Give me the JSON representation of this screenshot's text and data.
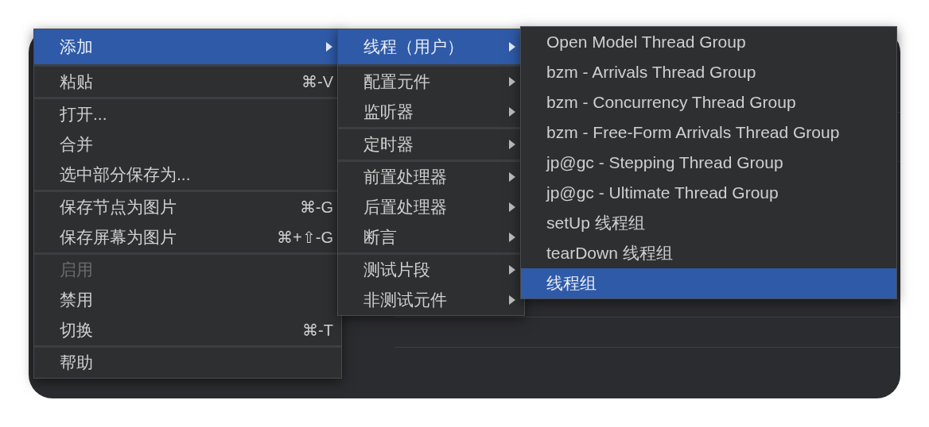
{
  "menus": [
    {
      "groups": [
        [
          {
            "label": "添加",
            "submenu": true,
            "selected": true,
            "disabled": false
          }
        ],
        [
          {
            "label": "粘贴",
            "shortcut": "⌘-V",
            "submenu": false,
            "selected": false,
            "disabled": false
          }
        ],
        [
          {
            "label": "打开...",
            "submenu": false,
            "selected": false,
            "disabled": false
          },
          {
            "label": "合并",
            "submenu": false,
            "selected": false,
            "disabled": false
          },
          {
            "label": "选中部分保存为...",
            "submenu": false,
            "selected": false,
            "disabled": false
          }
        ],
        [
          {
            "label": "保存节点为图片",
            "shortcut": "⌘-G",
            "submenu": false,
            "selected": false,
            "disabled": false
          },
          {
            "label": "保存屏幕为图片",
            "shortcut": "⌘+⇧-G",
            "submenu": false,
            "selected": false,
            "disabled": false
          }
        ],
        [
          {
            "label": "启用",
            "submenu": false,
            "selected": false,
            "disabled": true
          },
          {
            "label": "禁用",
            "submenu": false,
            "selected": false,
            "disabled": false
          },
          {
            "label": "切换",
            "shortcut": "⌘-T",
            "submenu": false,
            "selected": false,
            "disabled": false
          }
        ],
        [
          {
            "label": "帮助",
            "submenu": false,
            "selected": false,
            "disabled": false
          }
        ]
      ]
    },
    {
      "groups": [
        [
          {
            "label": "线程（用户）",
            "submenu": true,
            "selected": true,
            "disabled": false
          }
        ],
        [
          {
            "label": "配置元件",
            "submenu": true,
            "selected": false,
            "disabled": false
          },
          {
            "label": "监听器",
            "submenu": true,
            "selected": false,
            "disabled": false
          }
        ],
        [
          {
            "label": "定时器",
            "submenu": true,
            "selected": false,
            "disabled": false
          }
        ],
        [
          {
            "label": "前置处理器",
            "submenu": true,
            "selected": false,
            "disabled": false
          },
          {
            "label": "后置处理器",
            "submenu": true,
            "selected": false,
            "disabled": false
          },
          {
            "label": "断言",
            "submenu": true,
            "selected": false,
            "disabled": false
          }
        ],
        [
          {
            "label": "测试片段",
            "submenu": true,
            "selected": false,
            "disabled": false
          },
          {
            "label": "非测试元件",
            "submenu": true,
            "selected": false,
            "disabled": false
          }
        ]
      ]
    },
    {
      "groups": [
        [
          {
            "label": "Open Model Thread Group",
            "submenu": false,
            "selected": false,
            "disabled": false
          },
          {
            "label": "bzm - Arrivals Thread Group",
            "submenu": false,
            "selected": false,
            "disabled": false
          },
          {
            "label": "bzm - Concurrency Thread Group",
            "submenu": false,
            "selected": false,
            "disabled": false
          },
          {
            "label": "bzm - Free-Form Arrivals Thread Group",
            "submenu": false,
            "selected": false,
            "disabled": false
          },
          {
            "label": "jp@gc - Stepping Thread Group",
            "submenu": false,
            "selected": false,
            "disabled": false
          },
          {
            "label": "jp@gc - Ultimate Thread Group",
            "submenu": false,
            "selected": false,
            "disabled": false
          },
          {
            "label": "setUp 线程组",
            "submenu": false,
            "selected": false,
            "disabled": false
          },
          {
            "label": "tearDown 线程组",
            "submenu": false,
            "selected": false,
            "disabled": false
          },
          {
            "label": "线程组",
            "submenu": false,
            "selected": true,
            "disabled": false
          }
        ]
      ]
    }
  ]
}
